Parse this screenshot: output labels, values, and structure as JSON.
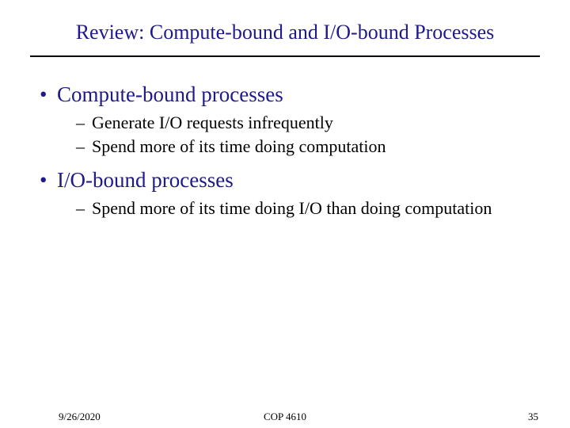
{
  "title": "Review: Compute-bound and I/O-bound Processes",
  "sections": [
    {
      "heading": "Compute-bound processes",
      "points": [
        "Generate I/O requests infrequently",
        "Spend more of its time doing computation"
      ]
    },
    {
      "heading": "I/O-bound processes",
      "points": [
        "Spend more of its time doing I/O than doing computation"
      ]
    }
  ],
  "footer": {
    "date": "9/26/2020",
    "course": "COP 4610",
    "page": "35"
  }
}
